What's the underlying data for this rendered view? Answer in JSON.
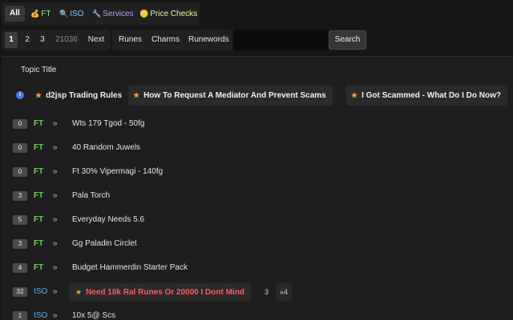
{
  "filters": [
    {
      "label": "All",
      "icon": "none"
    },
    {
      "label": "FT",
      "icon": "money-bag-icon"
    },
    {
      "label": "ISO",
      "icon": "magnifier-icon"
    },
    {
      "label": "Services",
      "icon": "wrench-icon"
    },
    {
      "label": "Price Checks",
      "icon": "coin-icon"
    }
  ],
  "pager": [
    "1",
    "2",
    "3",
    "21036",
    "Next"
  ],
  "categories": [
    "Runes",
    "Charms",
    "Runewords"
  ],
  "search": {
    "value": "",
    "button": "Search"
  },
  "table": {
    "header": "Topic Title",
    "sticky": [
      "d2jsp Trading Rules",
      "How To Request A Mediator And Prevent Scams",
      "I Got Scammed - What Do I Do Now?"
    ],
    "rows": [
      {
        "replies": "0",
        "type": "FT",
        "arrow": "»",
        "title": "Wts 179 Tgod - 50fg"
      },
      {
        "replies": "0",
        "type": "FT",
        "arrow": "»",
        "title": "40 Random Juwels"
      },
      {
        "replies": "0",
        "type": "FT",
        "arrow": "»",
        "title": "Ft 30% Vipermagi - 140fg"
      },
      {
        "replies": "3",
        "type": "FT",
        "arrow": "»",
        "title": "Pala Torch"
      },
      {
        "replies": "5",
        "type": "FT",
        "arrow": "»",
        "title": "Everyday Needs 5.6"
      },
      {
        "replies": "3",
        "type": "FT",
        "arrow": "»",
        "title": "Gg Paladin Circlet"
      },
      {
        "replies": "4",
        "type": "FT",
        "arrow": "»",
        "title": "Budget Hammerdin Starter Pack"
      },
      {
        "replies": "32",
        "type": "ISO",
        "arrow": "»",
        "title": "Need 10k Ral Runes Or 20000 I Dont Mind",
        "page_a": "3",
        "page_b": "»4"
      },
      {
        "replies": "1",
        "type": "ISO",
        "arrow": "»",
        "title": "10x 5@ Scs"
      }
    ]
  },
  "colors": {
    "background": "#161616",
    "panel": "#1e1e1e",
    "ft": "#74c463",
    "iso": "#5faee8",
    "hot_title": "#ff5a5a",
    "star": "#f0a23c"
  }
}
